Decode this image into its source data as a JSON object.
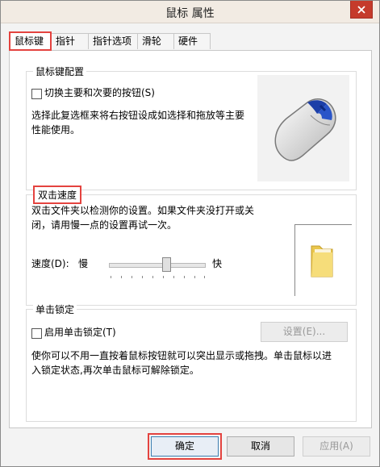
{
  "window": {
    "title": "鼠标 属性"
  },
  "tabs": [
    {
      "label": "鼠标键",
      "active": true
    },
    {
      "label": "指针"
    },
    {
      "label": "指针选项"
    },
    {
      "label": "滑轮"
    },
    {
      "label": "硬件"
    }
  ],
  "button_config": {
    "legend": "鼠标键配置",
    "swap_label": "切换主要和次要的按钮(S)",
    "description_line1": "选择此复选框来将右按钮设成如选择和拖放等主要",
    "description_line2": "性能使用。"
  },
  "double_click": {
    "legend": "双击速度",
    "description_line1": "双击文件夹以检测你的设置。如果文件夹没打开或关",
    "description_line2": "闭，请用慢一点的设置再试一次。",
    "speed_label": "速度(D):",
    "slow_label": "慢",
    "fast_label": "快",
    "speed_value": 0.6
  },
  "click_lock": {
    "legend": "单击锁定",
    "enable_label": "启用单击锁定(T)",
    "settings_button": "设置(E)...",
    "description_line1": "使你可以不用一直按着鼠标按钮就可以突出显示或拖拽。单击鼠标以进",
    "description_line2": "入锁定状态,再次单击鼠标可解除锁定。"
  },
  "footer": {
    "ok": "确定",
    "cancel": "取消",
    "apply": "应用(A)"
  },
  "colors": {
    "highlight": "#e4433f",
    "close_button": "#c53b2c"
  }
}
